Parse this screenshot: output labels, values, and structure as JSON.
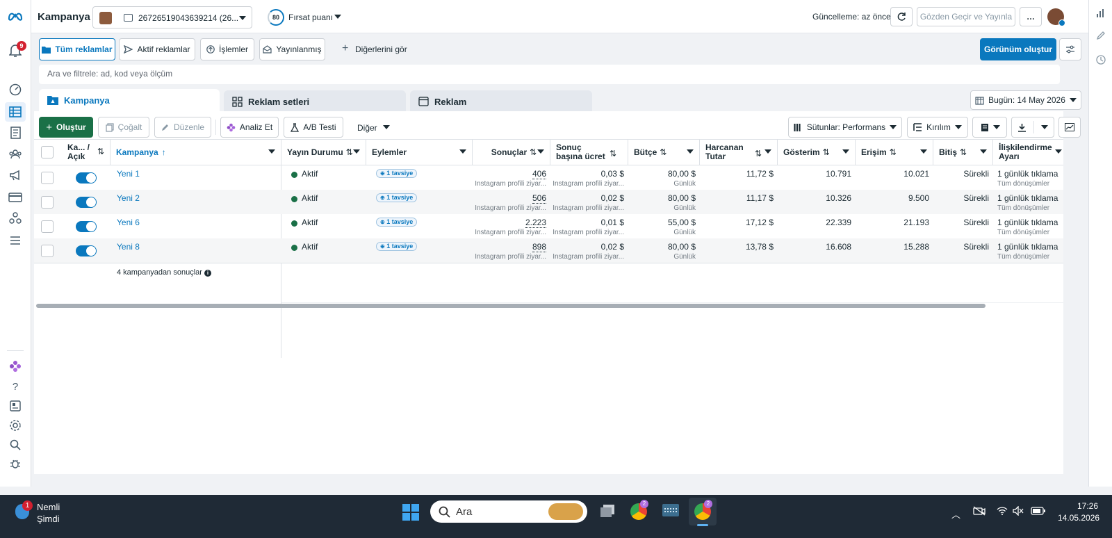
{
  "topbar": {
    "title": "Kampanya",
    "account_id": "26726519043639214 (26...",
    "opportunity_score": "80",
    "opportunity_label": "Fırsat puanı",
    "update_status": "Güncelleme: az önce",
    "review_publish": "Gözden Geçir ve Yayınla",
    "more": "…"
  },
  "nav": {
    "notifications_badge": "9"
  },
  "filters": {
    "all_ads": "Tüm reklamlar",
    "active_ads": "Aktif reklamlar",
    "actions": "İşlemler",
    "published": "Yayınlanmış",
    "see_more": "Diğerlerini gör",
    "create_view": "Görünüm oluştur"
  },
  "search": {
    "placeholder": "Ara ve filtrele: ad, kod veya ölçüm"
  },
  "tabs": {
    "campaign": "Kampanya",
    "ad_sets": "Reklam setleri",
    "ads": "Reklam"
  },
  "date": "Bugün: 14 May 2026",
  "toolbar": {
    "create": "Oluştur",
    "duplicate": "Çoğalt",
    "edit": "Düzenle",
    "analyze": "Analiz Et",
    "ab_test": "A/B Testi",
    "other": "Diğer",
    "columns": "Sütunlar: Performans",
    "breakdown": "Kırılım"
  },
  "table": {
    "headers": {
      "toggle": "Ka... / Açık",
      "campaign": "Kampanya",
      "status": "Yayın Durumu",
      "actions": "Eylemler",
      "results": "Sonuçlar",
      "cost": "Sonuç başına ücret",
      "budget": "Bütçe",
      "spent": "Harcanan Tutar",
      "impressions": "Gösterim",
      "reach": "Erişim",
      "end": "Bitiş",
      "attribution": "İlişkilendirme Ayarı"
    },
    "rows": [
      {
        "name": "Yeni 1",
        "status": "Aktif",
        "recommendation": "1 tavsiye",
        "results": "406",
        "results_sub": "Instagram profili ziyar...",
        "cost": "0,03 $",
        "cost_sub": "Instagram profili ziyar...",
        "budget": "80,00 $",
        "budget_sub": "Günlük",
        "spent": "11,72 $",
        "impressions": "10.791",
        "reach": "10.021",
        "end": "Sürekli",
        "attr": "1 günlük tıklama",
        "attr_sub": "Tüm dönüşümler"
      },
      {
        "name": "Yeni 2",
        "status": "Aktif",
        "recommendation": "1 tavsiye",
        "results": "506",
        "results_sub": "Instagram profili ziyar...",
        "cost": "0,02 $",
        "cost_sub": "Instagram profili ziyar...",
        "budget": "80,00 $",
        "budget_sub": "Günlük",
        "spent": "11,17 $",
        "impressions": "10.326",
        "reach": "9.500",
        "end": "Sürekli",
        "attr": "1 günlük tıklama",
        "attr_sub": "Tüm dönüşümler"
      },
      {
        "name": "Yeni 6",
        "status": "Aktif",
        "recommendation": "1 tavsiye",
        "results": "2.223",
        "results_sub": "Instagram profili ziyar...",
        "cost": "0,01 $",
        "cost_sub": "Instagram profili ziyar...",
        "budget": "55,00 $",
        "budget_sub": "Günlük",
        "spent": "17,12 $",
        "impressions": "22.339",
        "reach": "21.193",
        "end": "Sürekli",
        "attr": "1 günlük tıklama",
        "attr_sub": "Tüm dönüşümler"
      },
      {
        "name": "Yeni 8",
        "status": "Aktif",
        "recommendation": "1 tavsiye",
        "results": "898",
        "results_sub": "Instagram profili ziyar...",
        "cost": "0,02 $",
        "cost_sub": "Instagram profili ziyar...",
        "budget": "80,00 $",
        "budget_sub": "Günlük",
        "spent": "13,78 $",
        "impressions": "16.608",
        "reach": "15.288",
        "end": "Sürekli",
        "attr": "1 günlük tıklama",
        "attr_sub": "Tüm dönüşümler"
      }
    ],
    "footer": "4 kampanyadan sonuçlar"
  },
  "taskbar": {
    "weather_title": "Nemli",
    "weather_sub": "Şimdi",
    "weather_badge": "1",
    "search": "Ara",
    "chrome_badge_1": "2",
    "chrome_badge_2": "2",
    "time": "17:26",
    "date": "14.05.2026"
  },
  "colors": {
    "accent": "#0a78be",
    "create_green": "#1a7047",
    "taskbar": "#1f2a36"
  }
}
